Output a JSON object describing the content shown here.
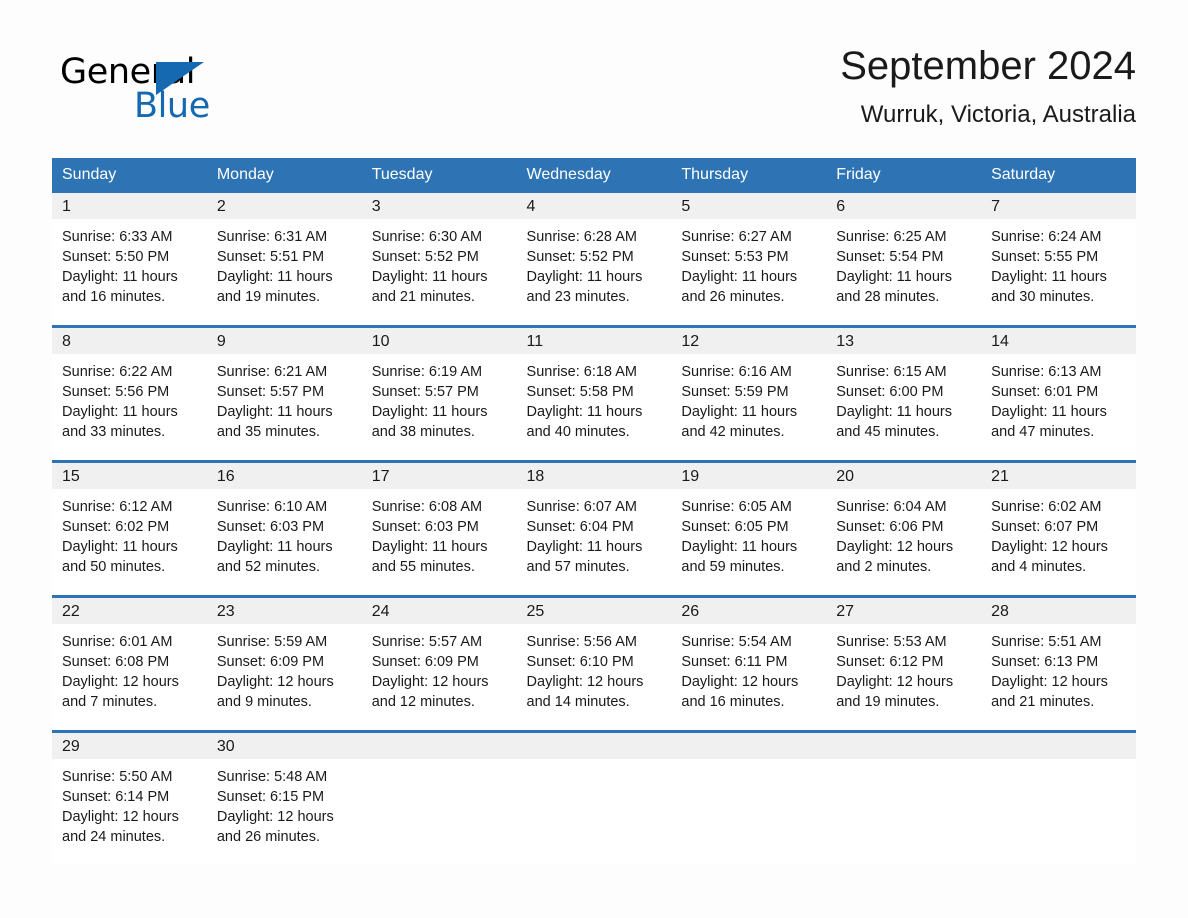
{
  "brand": {
    "name_part1": "General",
    "name_part2": "Blue",
    "triangle_color": "#1569b0"
  },
  "header": {
    "title": "September 2024",
    "subtitle": "Wurruk, Victoria, Australia"
  },
  "colors": {
    "header_blue": "#2e74b5",
    "daynum_band": "#f0f0f0",
    "page_background": "#fdfdfd",
    "text": "#1a1a1a"
  },
  "weekday_headers": [
    "Sunday",
    "Monday",
    "Tuesday",
    "Wednesday",
    "Thursday",
    "Friday",
    "Saturday"
  ],
  "weeks": [
    [
      {
        "day": "1",
        "sunrise": "Sunrise: 6:33 AM",
        "sunset": "Sunset: 5:50 PM",
        "daylight": "Daylight: 11 hours and 16 minutes."
      },
      {
        "day": "2",
        "sunrise": "Sunrise: 6:31 AM",
        "sunset": "Sunset: 5:51 PM",
        "daylight": "Daylight: 11 hours and 19 minutes."
      },
      {
        "day": "3",
        "sunrise": "Sunrise: 6:30 AM",
        "sunset": "Sunset: 5:52 PM",
        "daylight": "Daylight: 11 hours and 21 minutes."
      },
      {
        "day": "4",
        "sunrise": "Sunrise: 6:28 AM",
        "sunset": "Sunset: 5:52 PM",
        "daylight": "Daylight: 11 hours and 23 minutes."
      },
      {
        "day": "5",
        "sunrise": "Sunrise: 6:27 AM",
        "sunset": "Sunset: 5:53 PM",
        "daylight": "Daylight: 11 hours and 26 minutes."
      },
      {
        "day": "6",
        "sunrise": "Sunrise: 6:25 AM",
        "sunset": "Sunset: 5:54 PM",
        "daylight": "Daylight: 11 hours and 28 minutes."
      },
      {
        "day": "7",
        "sunrise": "Sunrise: 6:24 AM",
        "sunset": "Sunset: 5:55 PM",
        "daylight": "Daylight: 11 hours and 30 minutes."
      }
    ],
    [
      {
        "day": "8",
        "sunrise": "Sunrise: 6:22 AM",
        "sunset": "Sunset: 5:56 PM",
        "daylight": "Daylight: 11 hours and 33 minutes."
      },
      {
        "day": "9",
        "sunrise": "Sunrise: 6:21 AM",
        "sunset": "Sunset: 5:57 PM",
        "daylight": "Daylight: 11 hours and 35 minutes."
      },
      {
        "day": "10",
        "sunrise": "Sunrise: 6:19 AM",
        "sunset": "Sunset: 5:57 PM",
        "daylight": "Daylight: 11 hours and 38 minutes."
      },
      {
        "day": "11",
        "sunrise": "Sunrise: 6:18 AM",
        "sunset": "Sunset: 5:58 PM",
        "daylight": "Daylight: 11 hours and 40 minutes."
      },
      {
        "day": "12",
        "sunrise": "Sunrise: 6:16 AM",
        "sunset": "Sunset: 5:59 PM",
        "daylight": "Daylight: 11 hours and 42 minutes."
      },
      {
        "day": "13",
        "sunrise": "Sunrise: 6:15 AM",
        "sunset": "Sunset: 6:00 PM",
        "daylight": "Daylight: 11 hours and 45 minutes."
      },
      {
        "day": "14",
        "sunrise": "Sunrise: 6:13 AM",
        "sunset": "Sunset: 6:01 PM",
        "daylight": "Daylight: 11 hours and 47 minutes."
      }
    ],
    [
      {
        "day": "15",
        "sunrise": "Sunrise: 6:12 AM",
        "sunset": "Sunset: 6:02 PM",
        "daylight": "Daylight: 11 hours and 50 minutes."
      },
      {
        "day": "16",
        "sunrise": "Sunrise: 6:10 AM",
        "sunset": "Sunset: 6:03 PM",
        "daylight": "Daylight: 11 hours and 52 minutes."
      },
      {
        "day": "17",
        "sunrise": "Sunrise: 6:08 AM",
        "sunset": "Sunset: 6:03 PM",
        "daylight": "Daylight: 11 hours and 55 minutes."
      },
      {
        "day": "18",
        "sunrise": "Sunrise: 6:07 AM",
        "sunset": "Sunset: 6:04 PM",
        "daylight": "Daylight: 11 hours and 57 minutes."
      },
      {
        "day": "19",
        "sunrise": "Sunrise: 6:05 AM",
        "sunset": "Sunset: 6:05 PM",
        "daylight": "Daylight: 11 hours and 59 minutes."
      },
      {
        "day": "20",
        "sunrise": "Sunrise: 6:04 AM",
        "sunset": "Sunset: 6:06 PM",
        "daylight": "Daylight: 12 hours and 2 minutes."
      },
      {
        "day": "21",
        "sunrise": "Sunrise: 6:02 AM",
        "sunset": "Sunset: 6:07 PM",
        "daylight": "Daylight: 12 hours and 4 minutes."
      }
    ],
    [
      {
        "day": "22",
        "sunrise": "Sunrise: 6:01 AM",
        "sunset": "Sunset: 6:08 PM",
        "daylight": "Daylight: 12 hours and 7 minutes."
      },
      {
        "day": "23",
        "sunrise": "Sunrise: 5:59 AM",
        "sunset": "Sunset: 6:09 PM",
        "daylight": "Daylight: 12 hours and 9 minutes."
      },
      {
        "day": "24",
        "sunrise": "Sunrise: 5:57 AM",
        "sunset": "Sunset: 6:09 PM",
        "daylight": "Daylight: 12 hours and 12 minutes."
      },
      {
        "day": "25",
        "sunrise": "Sunrise: 5:56 AM",
        "sunset": "Sunset: 6:10 PM",
        "daylight": "Daylight: 12 hours and 14 minutes."
      },
      {
        "day": "26",
        "sunrise": "Sunrise: 5:54 AM",
        "sunset": "Sunset: 6:11 PM",
        "daylight": "Daylight: 12 hours and 16 minutes."
      },
      {
        "day": "27",
        "sunrise": "Sunrise: 5:53 AM",
        "sunset": "Sunset: 6:12 PM",
        "daylight": "Daylight: 12 hours and 19 minutes."
      },
      {
        "day": "28",
        "sunrise": "Sunrise: 5:51 AM",
        "sunset": "Sunset: 6:13 PM",
        "daylight": "Daylight: 12 hours and 21 minutes."
      }
    ],
    [
      {
        "day": "29",
        "sunrise": "Sunrise: 5:50 AM",
        "sunset": "Sunset: 6:14 PM",
        "daylight": "Daylight: 12 hours and 24 minutes."
      },
      {
        "day": "30",
        "sunrise": "Sunrise: 5:48 AM",
        "sunset": "Sunset: 6:15 PM",
        "daylight": "Daylight: 12 hours and 26 minutes."
      },
      {
        "day": "",
        "sunrise": "",
        "sunset": "",
        "daylight": ""
      },
      {
        "day": "",
        "sunrise": "",
        "sunset": "",
        "daylight": ""
      },
      {
        "day": "",
        "sunrise": "",
        "sunset": "",
        "daylight": ""
      },
      {
        "day": "",
        "sunrise": "",
        "sunset": "",
        "daylight": ""
      },
      {
        "day": "",
        "sunrise": "",
        "sunset": "",
        "daylight": ""
      }
    ]
  ]
}
